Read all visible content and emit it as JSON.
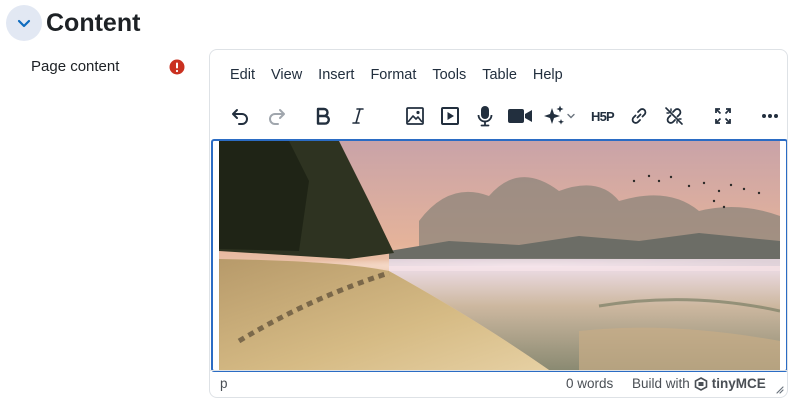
{
  "section": {
    "title": "Content"
  },
  "field": {
    "label": "Page content"
  },
  "editor": {
    "menu": [
      "Edit",
      "View",
      "Insert",
      "Format",
      "Tools",
      "Table",
      "Help"
    ],
    "toolbar_icons": [
      "undo-icon",
      "redo-icon",
      "bold-icon",
      "italic-icon",
      "image-icon",
      "media-icon",
      "microphone-icon",
      "video-camera-icon",
      "ai-sparkle-icon",
      "h5p-icon",
      "link-icon",
      "unlink-icon",
      "fullscreen-icon",
      "more-icon"
    ],
    "h5p_label": "H5P",
    "content_image": "beach-sunset-image",
    "status": {
      "path": "p",
      "word_count": "0 words",
      "build_with": "Build with",
      "brand": "tinyMCE"
    }
  },
  "colors": {
    "accent": "#0f6cbf",
    "required": "#ca3120",
    "focus_border": "#2b6cc4"
  }
}
